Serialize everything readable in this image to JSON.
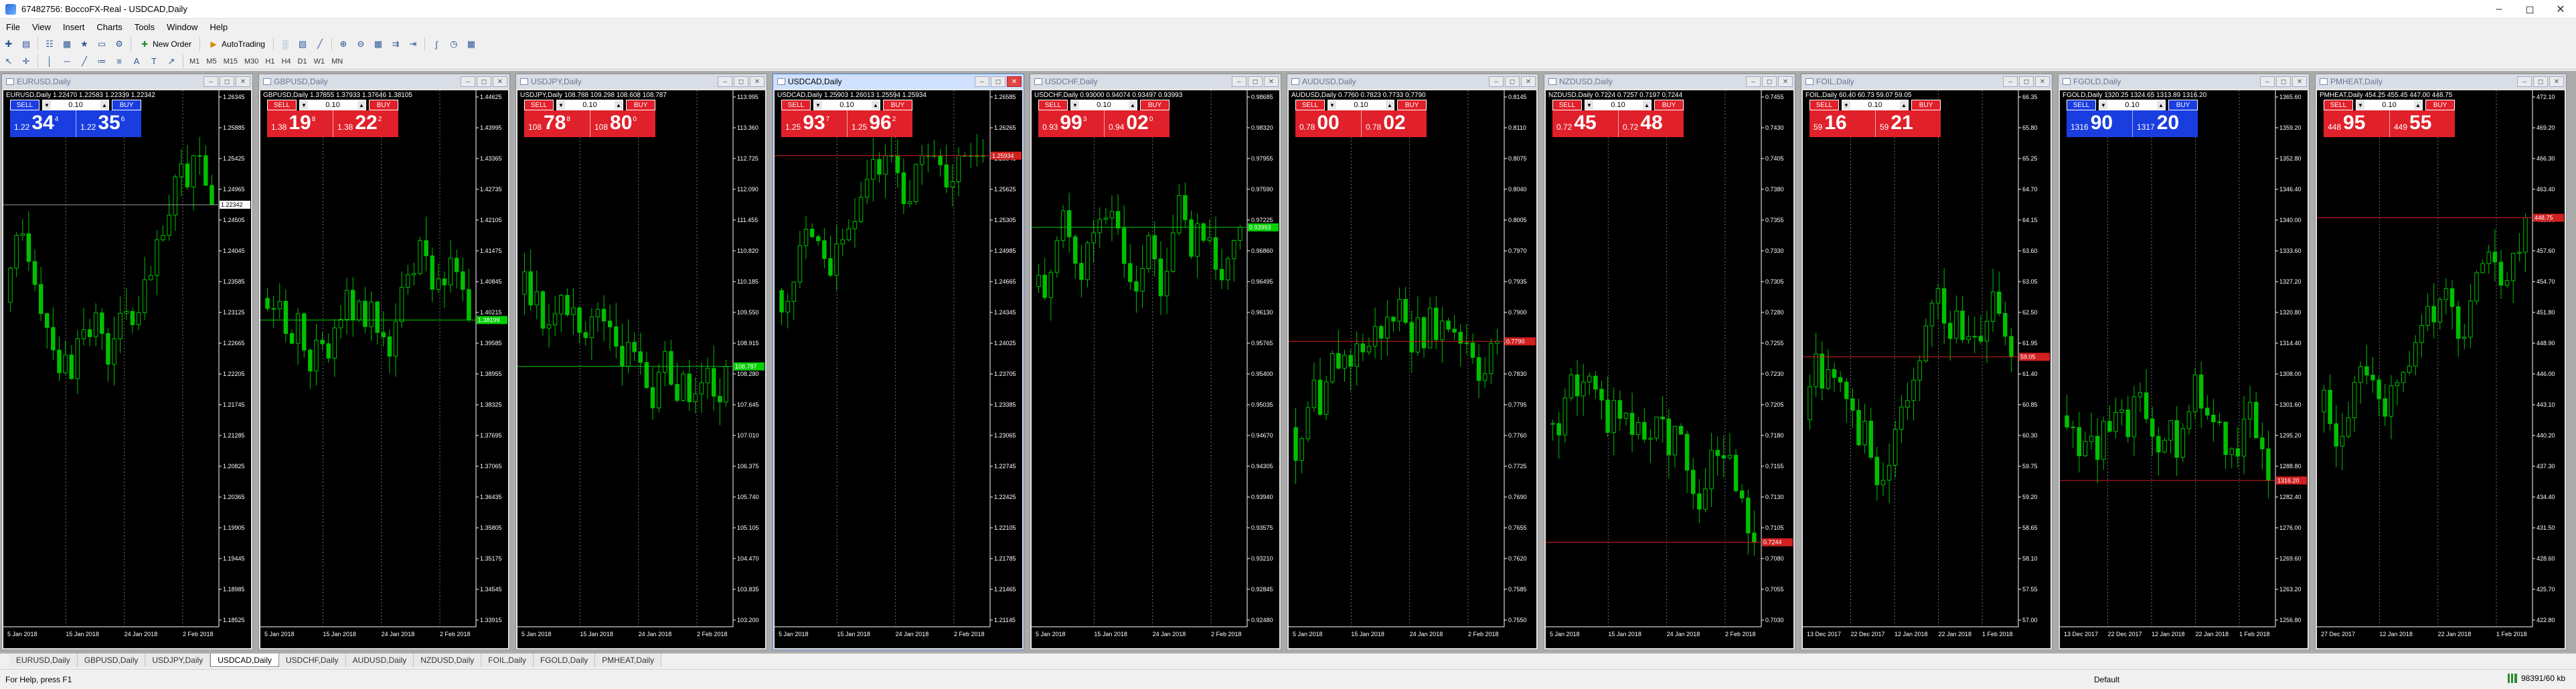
{
  "window": {
    "title": "67482756: BoccoFX-Real - USDCAD,Daily",
    "controls": [
      "minimize",
      "maximize",
      "close"
    ]
  },
  "menu": [
    "File",
    "View",
    "Insert",
    "Charts",
    "Tools",
    "Window",
    "Help"
  ],
  "toolbar": {
    "new_order_label": "New Order",
    "autotrading_label": "AutoTrading",
    "timeframes": [
      "M1",
      "M5",
      "M15",
      "M30",
      "H1",
      "H4",
      "D1",
      "W1",
      "MN"
    ]
  },
  "charts": [
    {
      "title": "EURUSD,Daily",
      "ohlc": "EURUSD,Daily 1.22470 1.22583 1.22339 1.22342",
      "sell_label": "SELL",
      "buy_label": "BUY",
      "lot": "0.10",
      "sell_small": "1.22",
      "sell_big": "34",
      "sell_sup": "4",
      "buy_small": "1.22",
      "buy_big": "35",
      "buy_sup": "6",
      "panel_color": "#1a3de0",
      "price_labels": [
        "1.26345",
        "1.25885",
        "1.25425",
        "1.24965",
        "1.24505",
        "1.24045",
        "1.23585",
        "1.23125",
        "1.22665",
        "1.22205",
        "1.21745",
        "1.21285",
        "1.20825",
        "1.20365",
        "1.19905",
        "1.19445",
        "1.18985",
        "1.18525"
      ],
      "date_labels": [
        "5 Jan 2018",
        "15 Jan 2018",
        "24 Jan 2018",
        "2 Feb 2018"
      ],
      "marker_price": "1.22342",
      "marker_color": "#ffffff"
    },
    {
      "title": "GBPUSD,Daily",
      "ohlc": "GBPUSD,Daily 1.37855 1.37933 1.37646 1.38105",
      "sell_label": "SELL",
      "buy_label": "BUY",
      "lot": "0.10",
      "sell_small": "1.38",
      "sell_big": "19",
      "sell_sup": "8",
      "buy_small": "1.38",
      "buy_big": "22",
      "buy_sup": "2",
      "panel_color": "#e0202a",
      "price_labels": [
        "1.44625",
        "1.43995",
        "1.43365",
        "1.42735",
        "1.42105",
        "1.41475",
        "1.40845",
        "1.40215",
        "1.39585",
        "1.38955",
        "1.38325",
        "1.37695",
        "1.37065",
        "1.36435",
        "1.35805",
        "1.35175",
        "1.34545",
        "1.33915"
      ],
      "date_labels": [
        "5 Jan 2018",
        "15 Jan 2018",
        "24 Jan 2018",
        "2 Feb 2018"
      ],
      "marker_price": "1.38199",
      "marker_color": "#00d000"
    },
    {
      "title": "USDJPY,Daily",
      "ohlc": "USDJPY,Daily 108.788 109.298 108.608 108.787",
      "sell_label": "SELL",
      "buy_label": "BUY",
      "lot": "0.10",
      "sell_small": "108",
      "sell_big": "78",
      "sell_sup": "8",
      "buy_small": "108",
      "buy_big": "80",
      "buy_sup": "0",
      "panel_color": "#e0202a",
      "price_labels": [
        "113.995",
        "113.360",
        "112.725",
        "112.090",
        "111.455",
        "110.820",
        "110.185",
        "109.550",
        "108.915",
        "108.280",
        "107.645",
        "107.010",
        "106.375",
        "105.740",
        "105.105",
        "104.470",
        "103.835",
        "103.200"
      ],
      "date_labels": [
        "5 Jan 2018",
        "15 Jan 2018",
        "24 Jan 2018",
        "2 Feb 2018"
      ],
      "marker_price": "108.787",
      "marker_color": "#00d000"
    },
    {
      "title": "USDCAD,Daily",
      "ohlc": "USDCAD,Daily 1.25903 1.26013 1.25594 1.25934",
      "sell_label": "SELL",
      "buy_label": "BUY",
      "lot": "0.10",
      "sell_small": "1.25",
      "sell_big": "93",
      "sell_sup": "7",
      "buy_small": "1.25",
      "buy_big": "96",
      "buy_sup": "2",
      "panel_color": "#e0202a",
      "price_labels": [
        "1.26585",
        "1.26265",
        "1.25945",
        "1.25625",
        "1.25305",
        "1.24985",
        "1.24665",
        "1.24345",
        "1.24025",
        "1.23705",
        "1.23385",
        "1.23065",
        "1.22745",
        "1.22425",
        "1.22105",
        "1.21785",
        "1.21465",
        "1.21145"
      ],
      "date_labels": [
        "5 Jan 2018",
        "15 Jan 2018",
        "24 Jan 2018",
        "2 Feb 2018"
      ],
      "marker_price": "1.25934",
      "marker_color": "#d02020"
    },
    {
      "title": "USDCHF,Daily",
      "ohlc": "USDCHF,Daily 0.93000 0.94074 0.93497 0.93993",
      "sell_label": "SELL",
      "buy_label": "BUY",
      "lot": "0.10",
      "sell_small": "0.93",
      "sell_big": "99",
      "sell_sup": "3",
      "buy_small": "0.94",
      "buy_big": "02",
      "buy_sup": "0",
      "panel_color": "#e0202a",
      "price_labels": [
        "0.98685",
        "0.98320",
        "0.97955",
        "0.97590",
        "0.97225",
        "0.96860",
        "0.96495",
        "0.96130",
        "0.95765",
        "0.95400",
        "0.95035",
        "0.94670",
        "0.94305",
        "0.93940",
        "0.93575",
        "0.93210",
        "0.92845",
        "0.92480"
      ],
      "date_labels": [
        "5 Jan 2018",
        "15 Jan 2018",
        "24 Jan 2018",
        "2 Feb 2018"
      ],
      "marker_price": "0.93993",
      "marker_color": "#00d000"
    },
    {
      "title": "AUDUSD,Daily",
      "ohlc": "AUDUSD,Daily 0.7760 0.7823 0.7733 0.7790",
      "sell_label": "SELL",
      "buy_label": "BUY",
      "lot": "0.10",
      "sell_small": "0.78",
      "sell_big": "00",
      "sell_sup": "",
      "buy_small": "0.78",
      "buy_big": "02",
      "buy_sup": "",
      "panel_color": "#e0202a",
      "price_labels": [
        "0.8145",
        "0.8110",
        "0.8075",
        "0.8040",
        "0.8005",
        "0.7970",
        "0.7935",
        "0.7900",
        "0.7865",
        "0.7830",
        "0.7795",
        "0.7760",
        "0.7725",
        "0.7690",
        "0.7655",
        "0.7620",
        "0.7585",
        "0.7550"
      ],
      "date_labels": [
        "5 Jan 2018",
        "15 Jan 2018",
        "24 Jan 2018",
        "2 Feb 2018"
      ],
      "marker_price": "0.7790",
      "marker_color": "#d02020"
    },
    {
      "title": "NZDUSD,Daily",
      "ohlc": "NZDUSD,Daily 0.7224 0.7257 0.7197 0.7244",
      "sell_label": "SELL",
      "buy_label": "BUY",
      "lot": "0.10",
      "sell_small": "0.72",
      "sell_big": "45",
      "sell_sup": "",
      "buy_small": "0.72",
      "buy_big": "48",
      "buy_sup": "",
      "panel_color": "#e0202a",
      "price_labels": [
        "0.7455",
        "0.7430",
        "0.7405",
        "0.7380",
        "0.7355",
        "0.7330",
        "0.7305",
        "0.7280",
        "0.7255",
        "0.7230",
        "0.7205",
        "0.7180",
        "0.7155",
        "0.7130",
        "0.7105",
        "0.7080",
        "0.7055",
        "0.7030"
      ],
      "date_labels": [
        "5 Jan 2018",
        "15 Jan 2018",
        "24 Jan 2018",
        "2 Feb 2018"
      ],
      "marker_price": "0.7244",
      "marker_color": "#d02020"
    },
    {
      "title": "FOIL,Daily",
      "ohlc": "FOIL,Daily 60.40 60.73 59.07 59.05",
      "sell_label": "SELL",
      "buy_label": "BUY",
      "lot": "0.10",
      "sell_small": "59",
      "sell_big": "16",
      "sell_sup": "",
      "buy_small": "59",
      "buy_big": "21",
      "buy_sup": "",
      "panel_color": "#e0202a",
      "price_labels": [
        "66.35",
        "65.80",
        "65.25",
        "64.70",
        "64.15",
        "63.60",
        "63.05",
        "62.50",
        "61.95",
        "61.40",
        "60.85",
        "60.30",
        "59.75",
        "59.20",
        "58.65",
        "58.10",
        "57.55",
        "57.00"
      ],
      "date_labels": [
        "13 Dec 2017",
        "22 Dec 2017",
        "12 Jan 2018",
        "22 Jan 2018",
        "1 Feb 2018"
      ],
      "marker_price": "59.05",
      "marker_color": "#d02020"
    },
    {
      "title": "FGOLD,Daily",
      "ohlc": "FGOLD,Daily 1320.25 1324.65 1313.89 1316.20",
      "sell_label": "SELL",
      "buy_label": "BUY",
      "lot": "0.10",
      "sell_small": "1316",
      "sell_big": "90",
      "sell_sup": "",
      "buy_small": "1317",
      "buy_big": "20",
      "buy_sup": "",
      "panel_color": "#1a3de0",
      "price_labels": [
        "1365.60",
        "1359.20",
        "1352.80",
        "1346.40",
        "1340.00",
        "1333.60",
        "1327.20",
        "1320.80",
        "1314.40",
        "1308.00",
        "1301.60",
        "1295.20",
        "1288.80",
        "1282.40",
        "1276.00",
        "1269.60",
        "1263.20",
        "1256.80"
      ],
      "date_labels": [
        "13 Dec 2017",
        "22 Dec 2017",
        "12 Jan 2018",
        "22 Jan 2018",
        "1 Feb 2018"
      ],
      "marker_price": "1316.20",
      "marker_color": "#d02020"
    },
    {
      "title": "PMHEAT,Daily",
      "ohlc": "PMHEAT,Daily 454.25 455.45 447.00 448.75",
      "sell_label": "SELL",
      "buy_label": "BUY",
      "lot": "0.10",
      "sell_small": "448",
      "sell_big": "95",
      "sell_sup": "",
      "buy_small": "449",
      "buy_big": "55",
      "buy_sup": "",
      "panel_color": "#e0202a",
      "price_labels": [
        "472.10",
        "469.20",
        "466.30",
        "463.40",
        "460.50",
        "457.60",
        "454.70",
        "451.80",
        "448.90",
        "446.00",
        "443.10",
        "440.20",
        "437.30",
        "434.40",
        "431.50",
        "428.60",
        "425.70",
        "422.80"
      ],
      "date_labels": [
        "27 Dec 2017",
        "12 Jan 2018",
        "22 Jan 2018",
        "1 Feb 2018"
      ],
      "marker_price": "448.75",
      "marker_color": "#d02020"
    }
  ],
  "tabs": [
    "EURUSD,Daily",
    "GBPUSD,Daily",
    "USDJPY,Daily",
    "USDCAD,Daily",
    "USDCHF,Daily",
    "AUDUSD,Daily",
    "NZDUSD,Daily",
    "FOIL,Daily",
    "FGOLD,Daily",
    "PMHEAT,Daily"
  ],
  "active_tab_index": 3,
  "statusbar": {
    "help": "For Help, press F1",
    "profile": "Default",
    "connection": "98391/60 kb"
  },
  "colors": {
    "chart_bg": "#000000",
    "candle": "#00c000",
    "grid": "#707070",
    "sell_panel_red": "#e0202a",
    "sell_panel_blue": "#1a3de0"
  }
}
